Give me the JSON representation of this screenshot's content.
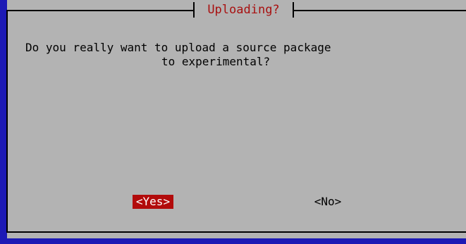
{
  "dialog": {
    "title": "Uploading?",
    "message_line1": "Do you really want to upload a source package",
    "message_line2": "to experimental?"
  },
  "buttons": {
    "yes_label": "<Yes>",
    "no_label": "<No>",
    "selected": "yes"
  },
  "colors": {
    "background": "#1d1ab5",
    "dialog": "#b3b3b3",
    "title": "#a81010",
    "selected_button": "#b20b0b"
  }
}
